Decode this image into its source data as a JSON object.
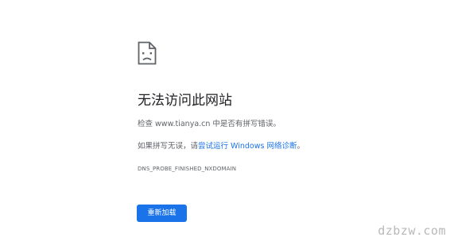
{
  "error_icon": "sad-page-icon",
  "title": "无法访问此网站",
  "check": {
    "prefix": "检查 ",
    "domain": "www.tianya.cn",
    "suffix": " 中是否有拼写错误。"
  },
  "suggestion": {
    "prefix": "如果拼写无误，请",
    "link": "尝试运行 Windows 网络诊断",
    "suffix": "。"
  },
  "error_code": "DNS_PROBE_FINISHED_NXDOMAIN",
  "reload_button": "重新加载",
  "watermark": "dzbzw.com",
  "colors": {
    "button": "#1a73e8",
    "link": "#1a73e8",
    "title": "#202124",
    "text": "#5f6368"
  }
}
